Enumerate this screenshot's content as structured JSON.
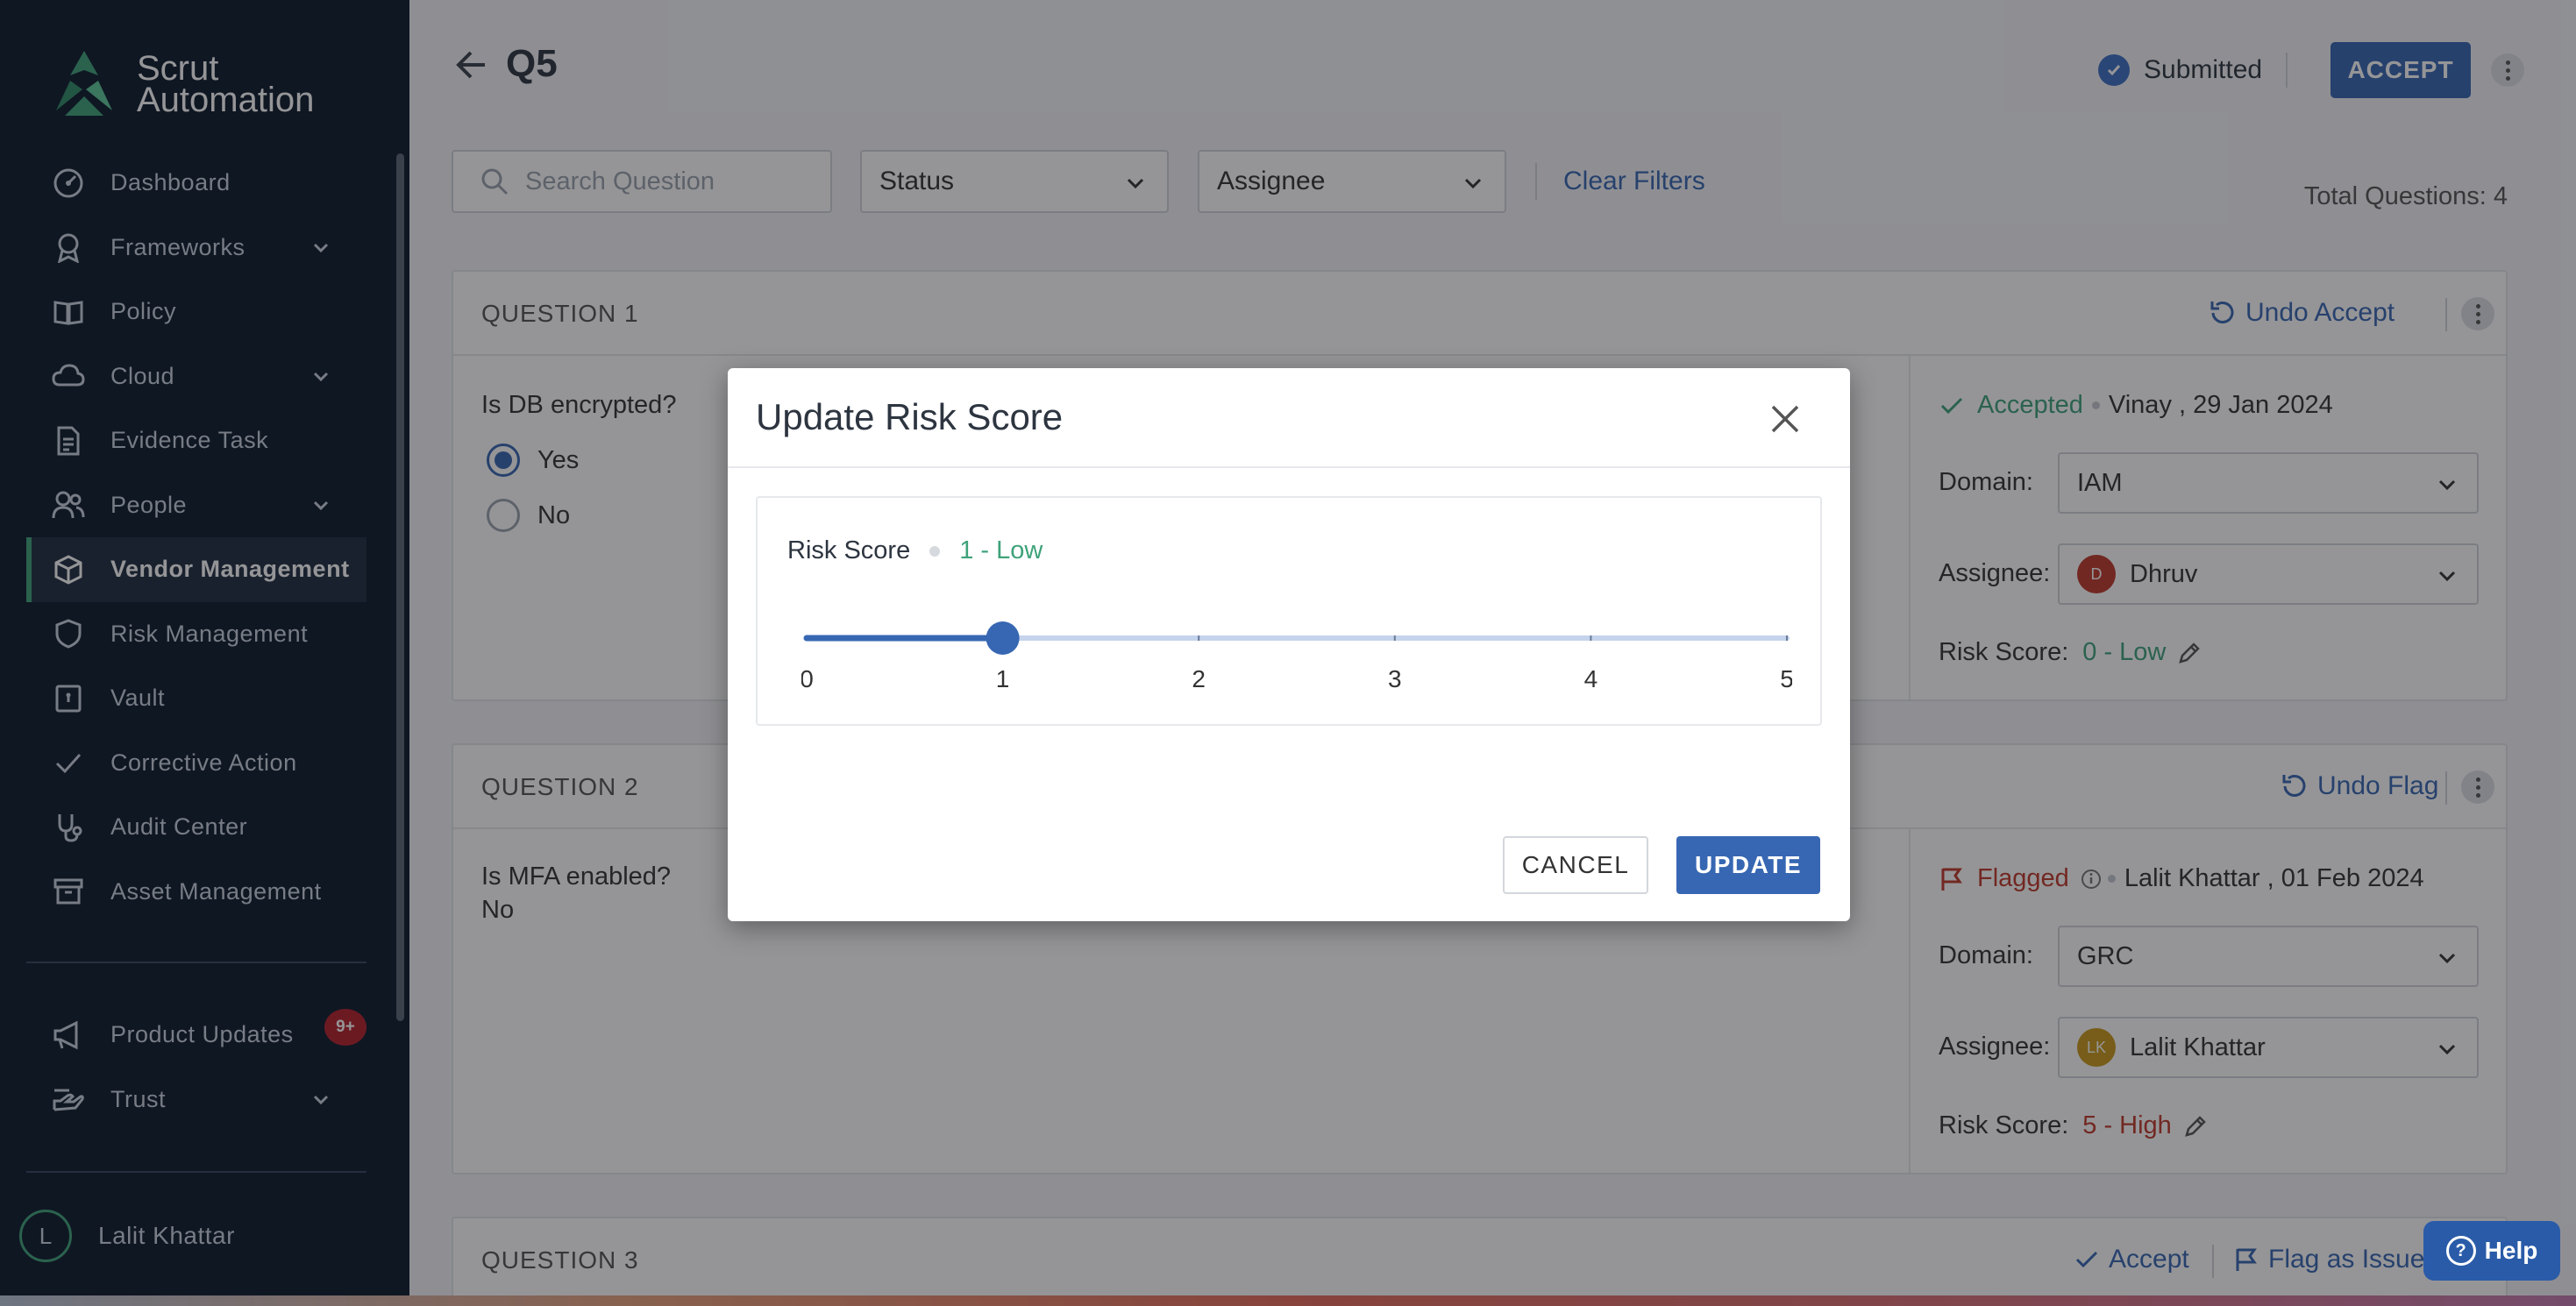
{
  "brand": {
    "name_line1": "Scrut",
    "name_line2": "Automation",
    "accent": "#3fa27a",
    "sidebar_bg": "#0b1a2c",
    "primary": "#3767b3"
  },
  "sidebar": {
    "items": [
      {
        "label": "Dashboard",
        "icon": "dashboard-icon",
        "has_chevron": false
      },
      {
        "label": "Frameworks",
        "icon": "award-icon",
        "has_chevron": true
      },
      {
        "label": "Policy",
        "icon": "book-icon",
        "has_chevron": false
      },
      {
        "label": "Cloud",
        "icon": "cloud-icon",
        "has_chevron": true
      },
      {
        "label": "Evidence Task",
        "icon": "document-icon",
        "has_chevron": false
      },
      {
        "label": "People",
        "icon": "people-icon",
        "has_chevron": true
      },
      {
        "label": "Vendor Management",
        "icon": "cube-icon",
        "has_chevron": false,
        "active": true
      },
      {
        "label": "Risk Management",
        "icon": "shield-icon",
        "has_chevron": false
      },
      {
        "label": "Vault",
        "icon": "vault-icon",
        "has_chevron": false
      },
      {
        "label": "Corrective Action",
        "icon": "check-icon",
        "has_chevron": false
      },
      {
        "label": "Audit Center",
        "icon": "stethoscope-icon",
        "has_chevron": false
      },
      {
        "label": "Asset Management",
        "icon": "archive-icon",
        "has_chevron": false
      }
    ],
    "bottom_items": [
      {
        "label": "Product Updates",
        "icon": "megaphone-icon",
        "badge": "9+"
      },
      {
        "label": "Trust",
        "icon": "trust-icon",
        "has_chevron": true
      }
    ],
    "user": {
      "initial": "L",
      "name": "Lalit Khattar"
    }
  },
  "header": {
    "title": "Q5",
    "status": "Submitted",
    "accept_label": "ACCEPT"
  },
  "filters": {
    "search_placeholder": "Search Question",
    "status_label": "Status",
    "assignee_label": "Assignee",
    "clear_label": "Clear Filters",
    "total": "Total Questions: 4"
  },
  "questions": [
    {
      "label": "QUESTION 1",
      "action": "Undo Accept",
      "text": "Is DB encrypted?",
      "options": [
        "Yes",
        "No"
      ],
      "selected": "Yes",
      "status": "Accepted",
      "by": "Vinay , 29 Jan 2024",
      "domain_label": "Domain:",
      "domain": "IAM",
      "assignee_label": "Assignee:",
      "assignee": "Dhruv",
      "assignee_initial": "D",
      "risk_label": "Risk Score:",
      "risk": "0 - Low"
    },
    {
      "label": "QUESTION 2",
      "action": "Undo Flag",
      "text": "Is MFA enabled?",
      "answer": "No",
      "status": "Flagged",
      "by": "Lalit Khattar , 01 Feb 2024",
      "domain_label": "Domain:",
      "domain": "GRC",
      "assignee_label": "Assignee:",
      "assignee": "Lalit Khattar",
      "assignee_initial": "LK",
      "risk_label": "Risk Score:",
      "risk": "5 - High"
    },
    {
      "label": "QUESTION 3",
      "action_accept": "Accept",
      "action_flag": "Flag as Issue"
    }
  ],
  "modal": {
    "title": "Update Risk Score",
    "score_label": "Risk Score",
    "score_value": "1 - Low",
    "slider": {
      "min": 0,
      "max": 5,
      "value": 1,
      "ticks": [
        "0",
        "1",
        "2",
        "3",
        "4",
        "5"
      ]
    },
    "cancel_label": "CANCEL",
    "update_label": "UPDATE"
  },
  "help_label": "Help"
}
